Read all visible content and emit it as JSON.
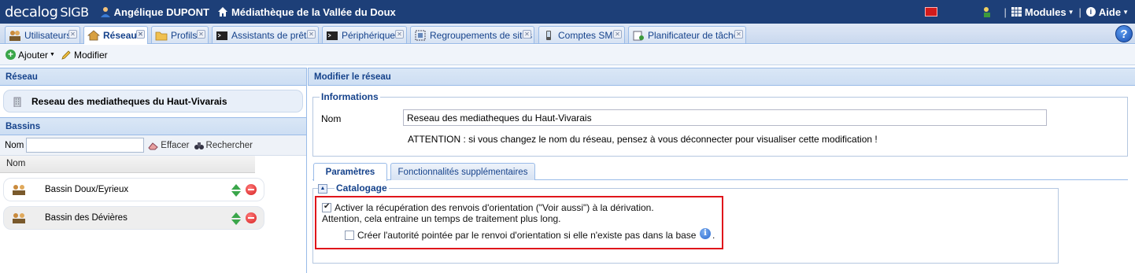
{
  "app": {
    "logo": "decalog",
    "logo_suffix": "SIGB",
    "user_name": "Angélique DUPONT",
    "library_name": "Médiathèque de la Vallée du Doux",
    "modules_label": "Modules",
    "help_label": "Aide",
    "help_icon_glyph": "?"
  },
  "tabs": [
    {
      "label": "Utilisateurs",
      "icon": "users-icon",
      "active": false
    },
    {
      "label": "Réseau",
      "icon": "home-icon",
      "active": true
    },
    {
      "label": "Profils",
      "icon": "folder-icon",
      "active": false
    },
    {
      "label": "Assistants de prêts",
      "icon": "terminal-icon",
      "active": false
    },
    {
      "label": "Périphériques",
      "icon": "terminal-icon",
      "active": false
    },
    {
      "label": "Regroupements de sites",
      "icon": "grid-icon",
      "active": false
    },
    {
      "label": "Comptes SMS",
      "icon": "phone-icon",
      "active": false
    },
    {
      "label": "Planificateur de tâches",
      "icon": "scheduler-icon",
      "active": false
    }
  ],
  "toolbar": {
    "add_label": "Ajouter",
    "edit_label": "Modifier"
  },
  "left": {
    "network_header": "Réseau",
    "network_item": "Reseau des mediatheques du Haut-Vivarais",
    "bassins_header": "Bassins",
    "search_label": "Nom",
    "search_value": "",
    "clear_label": "Effacer",
    "search_button_label": "Rechercher",
    "column_header": "Nom",
    "bassins": [
      {
        "name": "Bassin Doux/Eyrieux"
      },
      {
        "name": "Bassin des Dévières"
      }
    ]
  },
  "right": {
    "header": "Modifier le réseau",
    "info_legend": "Informations",
    "nom_label": "Nom",
    "nom_value": "Reseau des mediatheques du Haut-Vivarais",
    "attention": "ATTENTION : si vous changez le nom du réseau, pensez à vous déconnecter pour visualiser cette modification !",
    "subtabs": [
      {
        "label": "Paramètres",
        "active": true
      },
      {
        "label": "Fonctionnalités supplémentaires",
        "active": false
      }
    ],
    "catalog_legend": "Catalogage",
    "option1_checked": true,
    "option1_label": "Activer la récupération des renvois d'orientation (\"Voir aussi\") à la dérivation.",
    "option1_note": "Attention, cela entraine un temps de traitement plus long.",
    "option2_checked": false,
    "option2_label": "Créer l'autorité pointée par le renvoi d'orientation si elle n'existe pas dans la base",
    "option2_suffix": ".",
    "info_icon_glyph": "i"
  },
  "colors": {
    "topbar": "#1d3f78",
    "highlight_border": "#e0151b",
    "header_text": "#15428b"
  }
}
